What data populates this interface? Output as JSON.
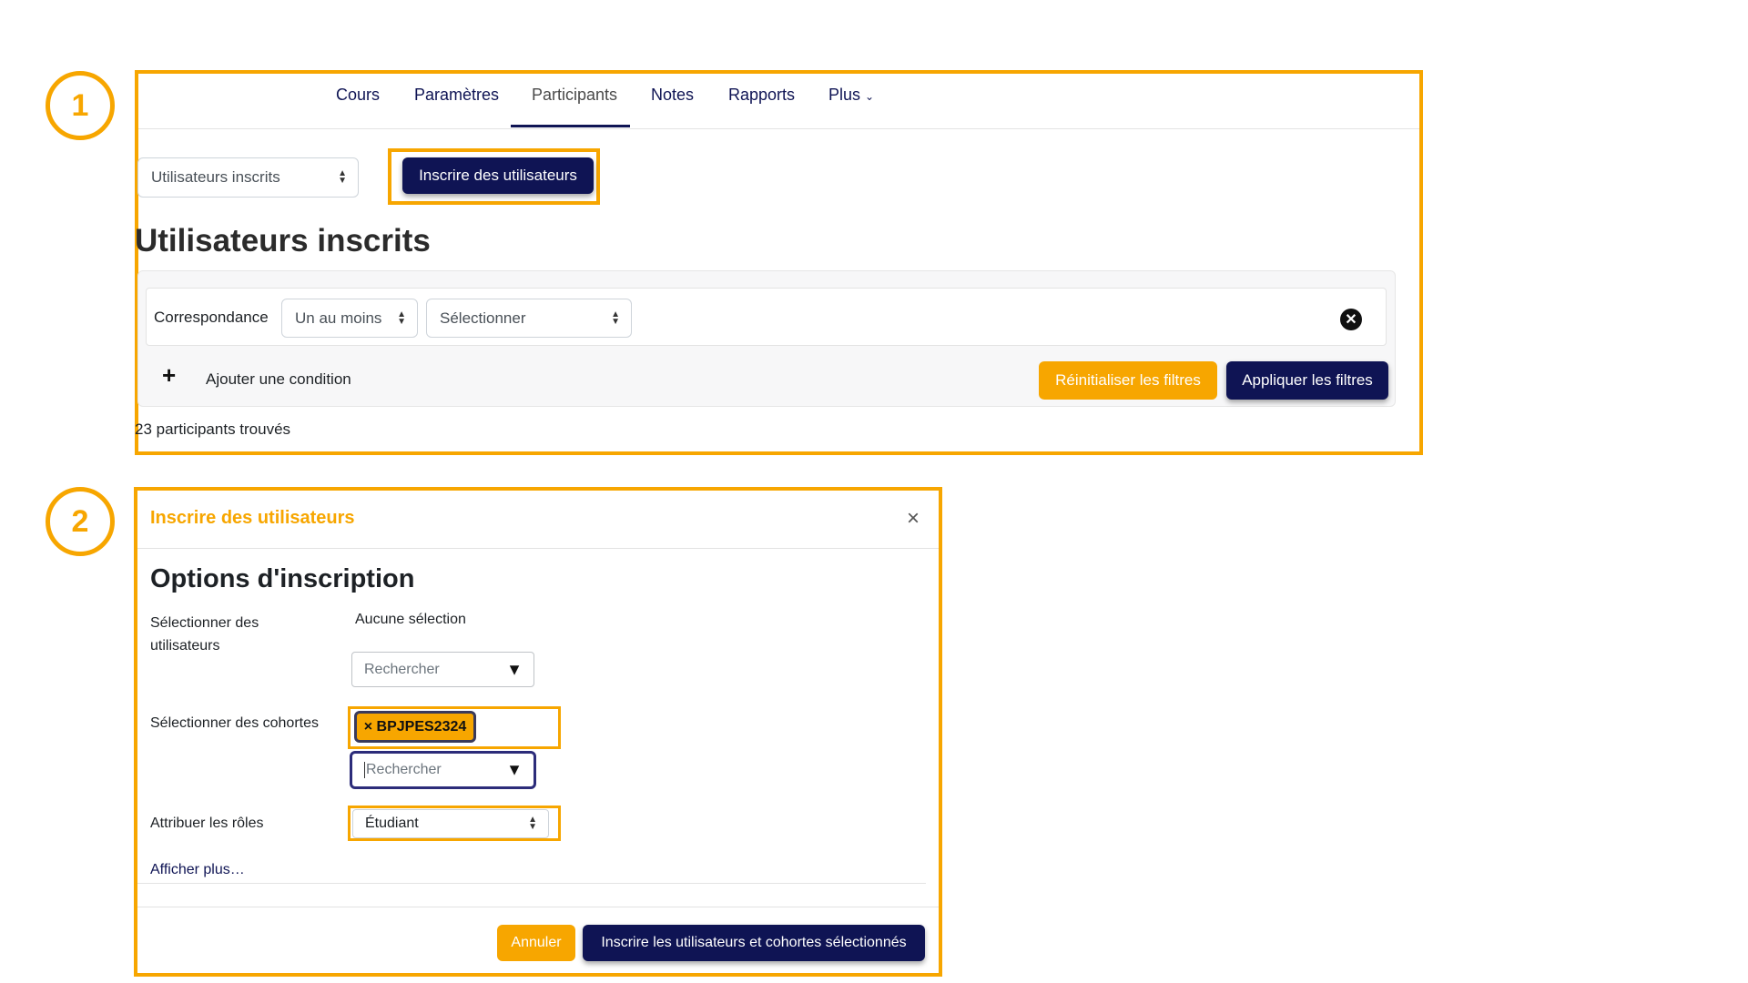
{
  "steps": {
    "one": "1",
    "two": "2"
  },
  "nav": {
    "tabs": [
      "Cours",
      "Paramètres",
      "Participants",
      "Notes",
      "Rapports",
      "Plus"
    ],
    "active": "Participants"
  },
  "enrol": {
    "select_value": "Utilisateurs inscrits",
    "enrol_button": "Inscrire des utilisateurs"
  },
  "page_title": "Utilisateurs inscrits",
  "filters": {
    "match_label": "Correspondance",
    "match_value": "Un au moins",
    "select_value": "Sélectionner",
    "add_condition": "Ajouter une condition",
    "reset_button": "Réinitialiser les filtres",
    "apply_button": "Appliquer les filtres"
  },
  "results_text": "23 participants trouvés",
  "modal": {
    "header": "Inscrire des utilisateurs",
    "section_title": "Options d'inscription",
    "users_label": "Sélectionner des utilisateurs",
    "users_selection": "Aucune sélection",
    "users_search_placeholder": "Rechercher",
    "cohorts_label": "Sélectionner des cohortes",
    "cohort_chip": "× BPJPES2324",
    "cohorts_search_placeholder": "Rechercher",
    "roles_label": "Attribuer les rôles",
    "role_value": "Étudiant",
    "show_more": "Afficher plus…",
    "cancel_button": "Annuler",
    "submit_button": "Inscrire les utilisateurs et cohortes sélectionnés"
  },
  "colors": {
    "accent_orange": "#f7a600",
    "navy": "#0f1454"
  }
}
